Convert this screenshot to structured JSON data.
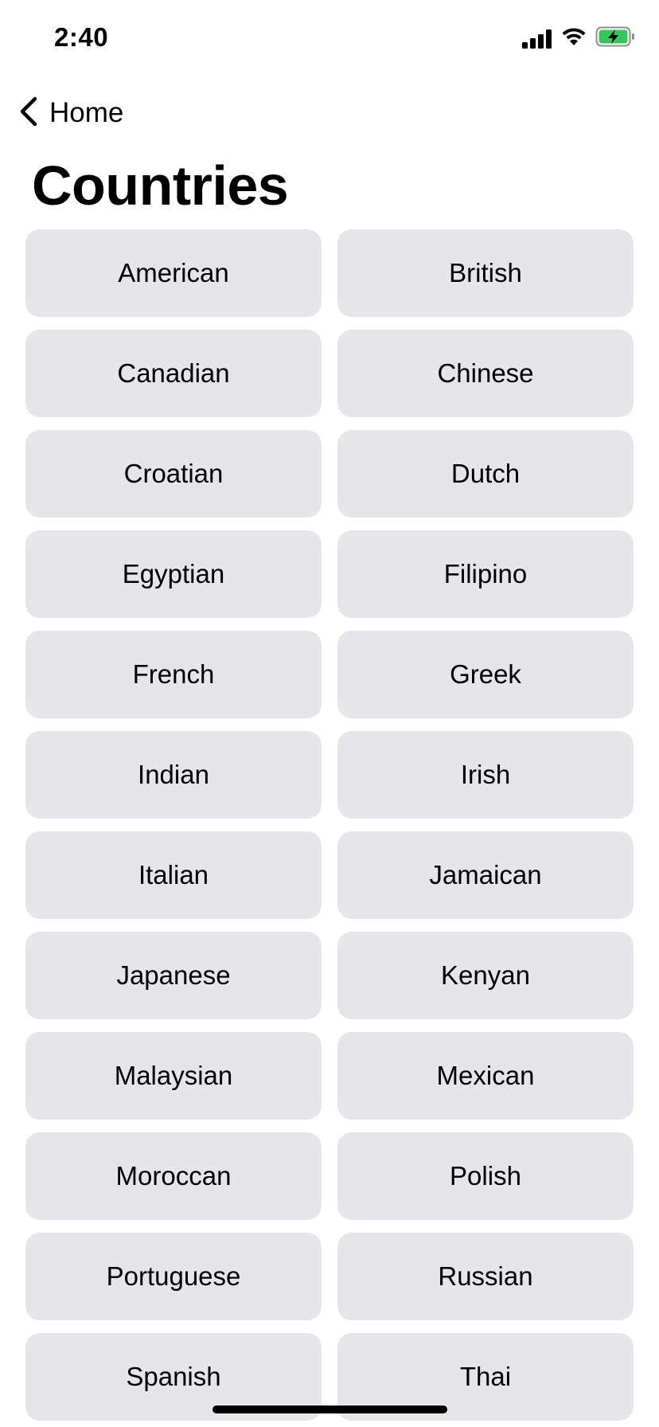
{
  "status_bar": {
    "time": "2:40",
    "icons": [
      "cellular-signal-icon",
      "wifi-icon",
      "battery-charging-icon"
    ],
    "battery_color": "#34c759"
  },
  "nav": {
    "back_label": "Home",
    "back_icon": "chevron-left-icon"
  },
  "title": "Countries",
  "countries": [
    "American",
    "British",
    "Canadian",
    "Chinese",
    "Croatian",
    "Dutch",
    "Egyptian",
    "Filipino",
    "French",
    "Greek",
    "Indian",
    "Irish",
    "Italian",
    "Jamaican",
    "Japanese",
    "Kenyan",
    "Malaysian",
    "Mexican",
    "Moroccan",
    "Polish",
    "Portuguese",
    "Russian",
    "Spanish",
    "Thai"
  ],
  "colors": {
    "button_background": "#e5e5ea",
    "text": "#000000",
    "background": "#ffffff"
  }
}
